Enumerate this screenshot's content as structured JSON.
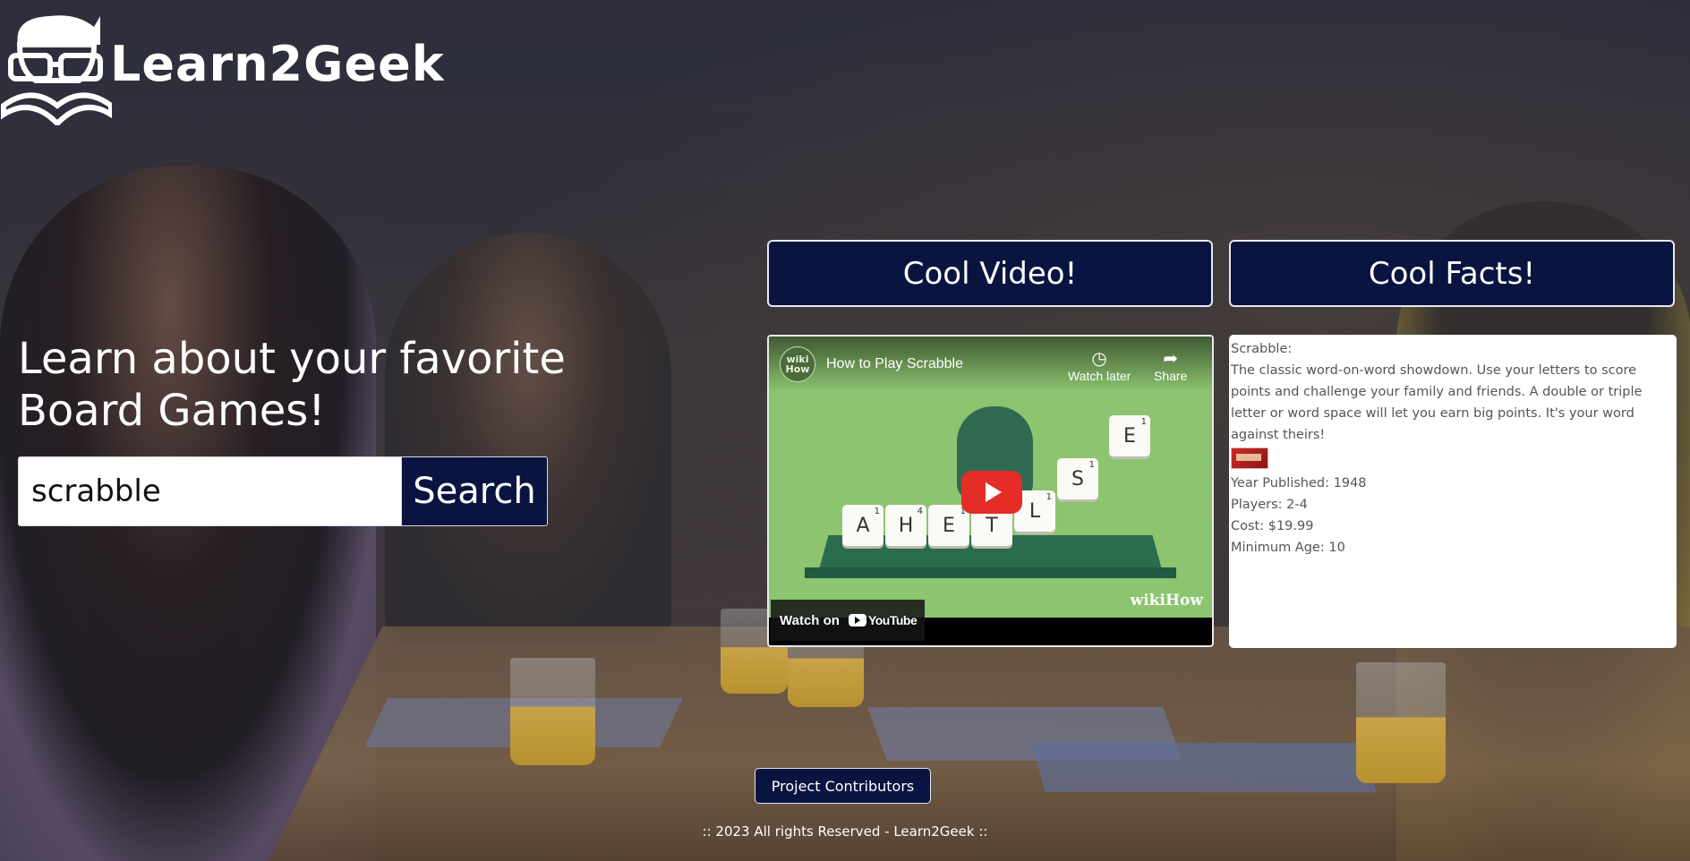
{
  "brand": {
    "name": "Learn2Geek"
  },
  "hero": {
    "title": "Learn about your favorite Board Games!",
    "search_value": "scrabble",
    "search_button": "Search"
  },
  "sections": {
    "video_title": "Cool Video!",
    "facts_title": "Cool Facts!"
  },
  "video": {
    "channel_badge": "wiki How",
    "title": "How to Play Scrabble",
    "watch_later": "Watch later",
    "share": "Share",
    "watch_on": "Watch on",
    "youtube": "YouTube",
    "watermark": "wikiHow",
    "tiles": [
      {
        "letter": "A",
        "score": "1"
      },
      {
        "letter": "H",
        "score": "4"
      },
      {
        "letter": "E",
        "score": "1"
      },
      {
        "letter": "T",
        "score": "1"
      },
      {
        "letter": "L",
        "score": "1"
      },
      {
        "letter": "S",
        "score": "1"
      },
      {
        "letter": "E",
        "score": "1"
      }
    ],
    "icons": {
      "watch_later": "clock-icon",
      "share": "share-arrow-icon",
      "play": "play-icon"
    }
  },
  "facts": {
    "name": "Scrabble:",
    "description": "The classic word-on-word showdown. Use your letters to score points and challenge your family and friends. A double or triple letter or word space will let you earn big points. It's your word against theirs!",
    "year": "Year Published: 1948",
    "players": "Players: 2-4",
    "cost": "Cost: $19.99",
    "min_age": "Minimum Age: 10"
  },
  "footer": {
    "contributors_button": "Project Contributors",
    "copyright": ":: 2023 All rights Reserved - Learn2Geek ::"
  },
  "colors": {
    "navy": "#0a1440",
    "accent_red": "#e52d27",
    "panel_border": "#e8e8ee"
  }
}
